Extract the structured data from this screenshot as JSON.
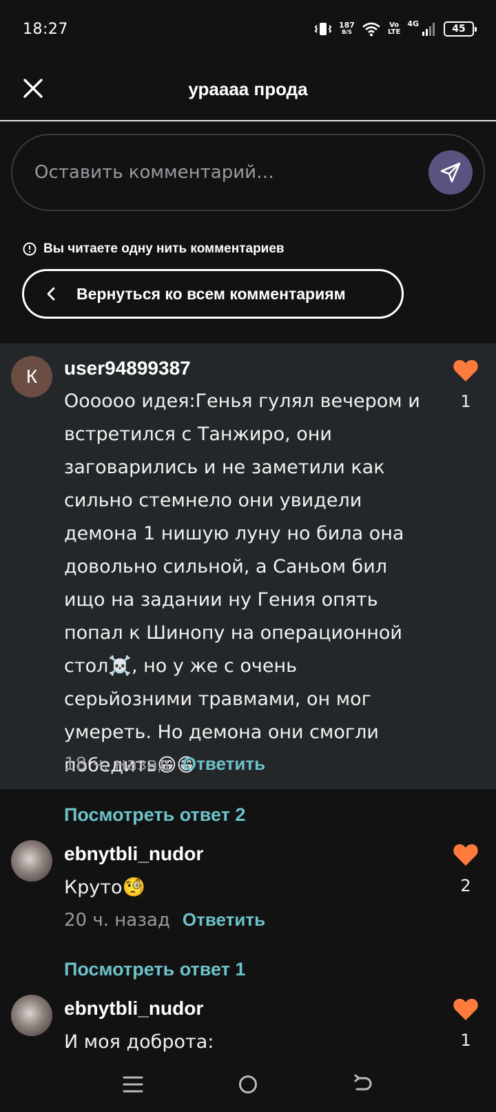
{
  "status_bar": {
    "time": "18:27",
    "speed_value": "187",
    "speed_unit": "B/S",
    "volte_top": "Vo",
    "volte_bottom": "LTE",
    "network": "4G",
    "battery": "45"
  },
  "header": {
    "title": "урaaaa прода",
    "close_icon": "close-icon"
  },
  "comment_input": {
    "placeholder": "Оставить комментарий…",
    "send_icon": "send-icon",
    "send_color": "#5a5380"
  },
  "thread": {
    "notice": "Вы читаете одну нить комментариев",
    "back_label": "Вернуться ко всем комментариям"
  },
  "comments": [
    {
      "avatar_letter": "К",
      "username": "user94899387",
      "text": "Оооооо идея:Генья гулял вечером и встретился с Танжиро,  они заговарились и не заметили как сильно стемнело они увидели демона 1 нишую луну но била она довольно сильной, а Саньом бил ищо на задании ну Гения опять попал к Шинопу на операционной стол☠️, но у же с очень серьйозними травмами, он мог умереть. Но демона они смогли победить😁😁",
      "ago": "18 ч. назад",
      "reply_label": "Ответить",
      "likes": "1"
    },
    {
      "view_reply": "Посмотреть ответ 2",
      "username": "ebnytbli_nudor",
      "text": "Круто🧐",
      "ago": "20 ч. назад",
      "reply_label": "Ответить",
      "likes": "2"
    },
    {
      "view_reply": "Посмотреть ответ 1",
      "username": "ebnytbli_nudor",
      "text": "И моя доброта:",
      "likes": "1"
    }
  ],
  "colors": {
    "accent_teal": "#6dc2c9",
    "heart": "#ff7a3d",
    "background": "#121213",
    "highlight": "#232729"
  }
}
